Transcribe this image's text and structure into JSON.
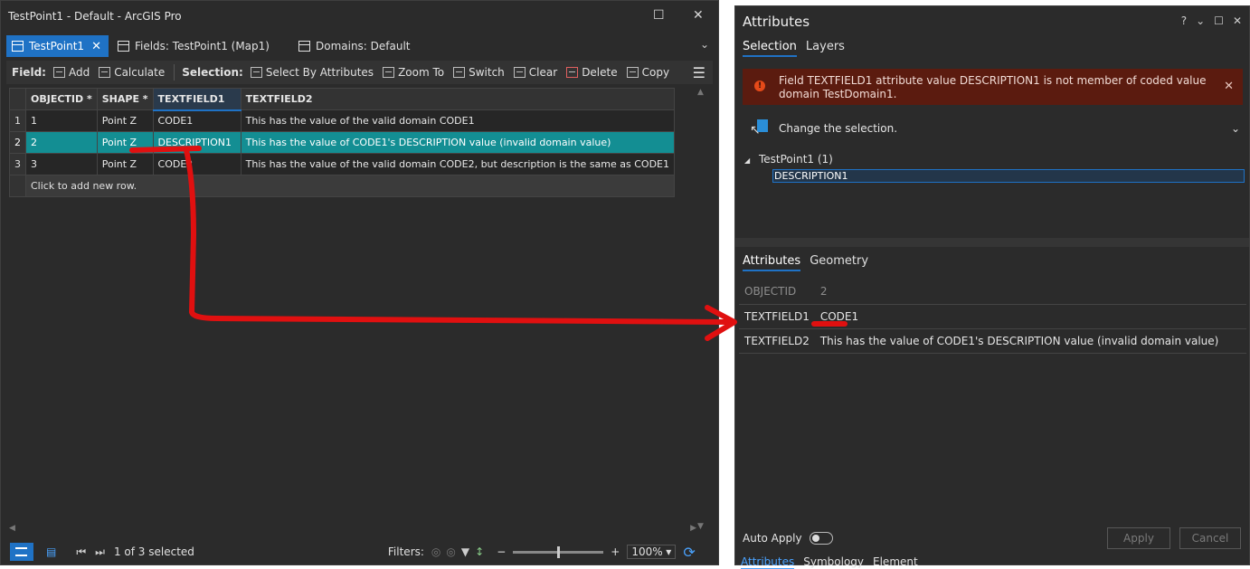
{
  "left_window": {
    "title": "TestPoint1 - Default - ArcGIS Pro",
    "tabs": [
      {
        "label": "TestPoint1"
      },
      {
        "label": "Fields: TestPoint1 (Map1)"
      },
      {
        "label": "Domains: Default"
      }
    ],
    "toolbar": {
      "field_label": "Field:",
      "add": "Add",
      "calculate": "Calculate",
      "selection_label": "Selection:",
      "select_by_attributes": "Select By Attributes",
      "zoom_to": "Zoom To",
      "switch": "Switch",
      "clear": "Clear",
      "delete": "Delete",
      "copy": "Copy"
    },
    "table": {
      "headers": [
        "OBJECTID *",
        "SHAPE *",
        "TEXTFIELD1",
        "TEXTFIELD2"
      ],
      "rows": [
        {
          "num": "1",
          "objectid": "1",
          "shape": "Point Z",
          "tf1": "CODE1",
          "tf2": "This has the value of the valid domain CODE1"
        },
        {
          "num": "2",
          "objectid": "2",
          "shape": "Point Z",
          "tf1": "DESCRIPTION1",
          "tf2": "This has the value of CODE1's DESCRIPTION value (invalid domain value)"
        },
        {
          "num": "3",
          "objectid": "3",
          "shape": "Point Z",
          "tf1": "CODE2",
          "tf2": "This has the value of the valid domain CODE2, but description is the same as CODE1"
        }
      ],
      "add_row": "Click to add new row."
    },
    "status": {
      "selected": "1 of 3 selected",
      "filters": "Filters:",
      "zoom": "100%",
      "zoom_level": 0.5
    }
  },
  "right_window": {
    "title": "Attributes",
    "controls": {
      "help": "?",
      "dropdown": "⌄"
    },
    "tabs": [
      "Selection",
      "Layers"
    ],
    "error": "Field TEXTFIELD1 attribute value DESCRIPTION1 is not member of coded value domain TestDomain1.",
    "change_selection": "Change the selection.",
    "tree": {
      "layer": "TestPoint1  (1)",
      "item": "DESCRIPTION1"
    },
    "attr_tabs": [
      "Attributes",
      "Geometry"
    ],
    "attributes": [
      {
        "key": "OBJECTID",
        "value": "2"
      },
      {
        "key": "TEXTFIELD1",
        "value": "CODE1"
      },
      {
        "key": "TEXTFIELD2",
        "value": "This has the value of CODE1's DESCRIPTION value (invalid domain value)"
      }
    ],
    "auto_apply": "Auto Apply",
    "apply": "Apply",
    "cancel": "Cancel",
    "bottom_tabs": [
      "Attributes",
      "Symbology",
      "Element"
    ]
  },
  "colors": {
    "accent": "#1f72c5",
    "selected_row": "#138e93",
    "error_bg": "#5b1b0f",
    "annotation": "#e01010"
  }
}
